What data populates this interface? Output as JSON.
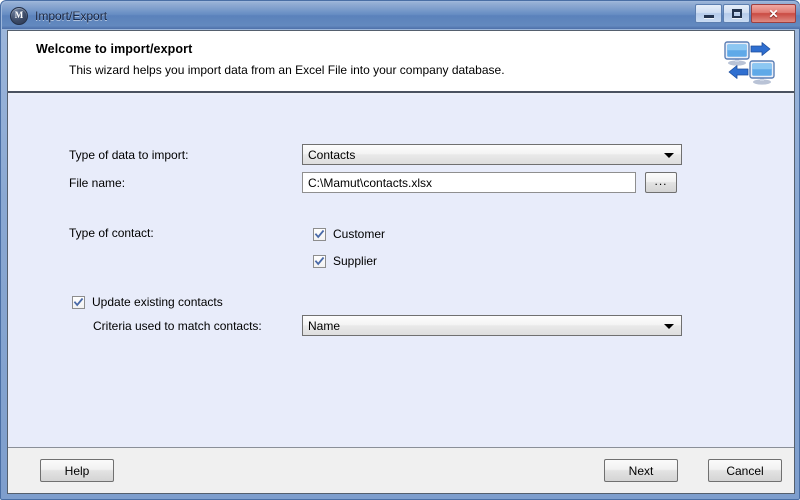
{
  "window": {
    "title": "Import/Export",
    "app_icon": "mamut-m-icon",
    "icon_letter": "M",
    "controls": {
      "minimize": "minimize-icon",
      "maximize": "maximize-icon",
      "close": "✕"
    }
  },
  "header": {
    "title": "Welcome to import/export",
    "subtitle": "This wizard helps you import data from an Excel File into your company database.",
    "icon": "import-export-computers-icon"
  },
  "form": {
    "data_type": {
      "label": "Type of data to import:",
      "value": "Contacts"
    },
    "file_name": {
      "label": "File name:",
      "value": "C:\\Mamut\\contacts.xlsx",
      "browse_label": "..."
    },
    "contact_type": {
      "label": "Type of contact:",
      "options": [
        {
          "label": "Customer",
          "checked": true
        },
        {
          "label": "Supplier",
          "checked": true
        }
      ]
    },
    "update_existing": {
      "label": "Update existing contacts",
      "checked": true
    },
    "criteria": {
      "label": "Criteria used to match contacts:",
      "value": "Name"
    }
  },
  "footer": {
    "help_label": "Help",
    "next_label": "Next",
    "cancel_label": "Cancel"
  },
  "colors": {
    "title_bar": "#5f87c0",
    "body_background": "#e8ecfa",
    "header_background": "#ffffff",
    "footer_background": "#f0f0f0",
    "close_button": "#c94a42",
    "check_mark": "#4a6aa8"
  }
}
